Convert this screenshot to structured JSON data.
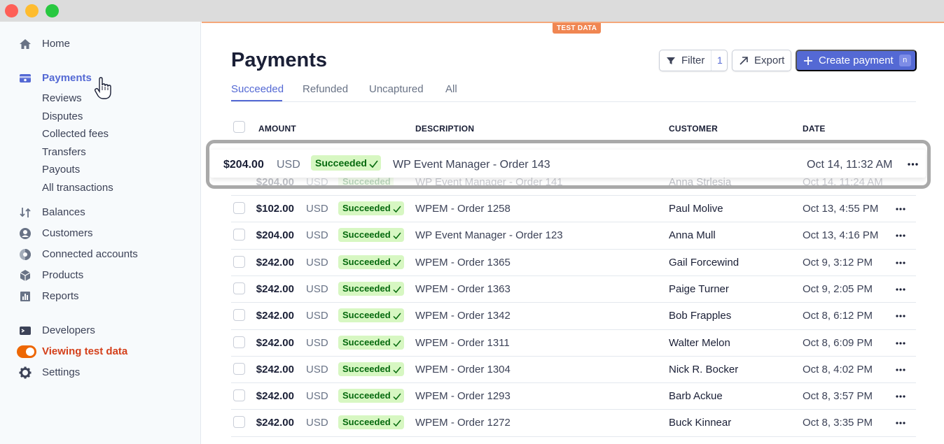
{
  "window": {
    "controls": [
      "close",
      "minimize",
      "maximize"
    ]
  },
  "env_badge": "TEST DATA",
  "sidebar": {
    "home": {
      "label": "Home",
      "icon": "home-icon"
    },
    "payments": {
      "label": "Payments",
      "icon": "payments-icon",
      "subitems": [
        "Reviews",
        "Disputes",
        "Collected fees",
        "Transfers",
        "Payouts",
        "All transactions"
      ]
    },
    "items": [
      {
        "label": "Balances",
        "icon": "balances-icon"
      },
      {
        "label": "Customers",
        "icon": "customers-icon"
      },
      {
        "label": "Connected accounts",
        "icon": "connected-accounts-icon"
      },
      {
        "label": "Products",
        "icon": "products-icon"
      },
      {
        "label": "Reports",
        "icon": "reports-icon"
      }
    ],
    "developers": {
      "label": "Developers",
      "icon": "terminal-icon"
    },
    "test_mode": {
      "label": "Viewing test data",
      "on": true
    },
    "settings": {
      "label": "Settings",
      "icon": "gear-icon"
    }
  },
  "main": {
    "title": "Payments",
    "toolbar": {
      "filter_label": "Filter",
      "filter_count": "1",
      "export_label": "Export",
      "create_label": "Create payment",
      "create_shortcut": "n"
    },
    "tabs": [
      "Succeeded",
      "Refunded",
      "Uncaptured",
      "All"
    ],
    "active_tab": "Succeeded",
    "columns": {
      "amount": "AMOUNT",
      "description": "DESCRIPTION",
      "customer": "CUSTOMER",
      "date": "DATE"
    },
    "highlighted_row": {
      "amount": "$204.00",
      "currency": "USD",
      "status": "Succeeded",
      "description": "WP Event Manager - Order 143",
      "date": "Oct 14, 11:32 AM"
    },
    "ghost_row": {
      "amount": "$204.00",
      "currency": "USD",
      "status": "Succeeded",
      "description": "WP Event Manager - Order 141",
      "customer": "Anna Strlesia",
      "date": "Oct 14, 11:24 AM"
    },
    "rows": [
      {
        "amount": "$102.00",
        "currency": "USD",
        "status": "Succeeded",
        "description": "WPEM - Order 1258",
        "customer": "Paul Molive",
        "date": "Oct 13, 4:55 PM"
      },
      {
        "amount": "$204.00",
        "currency": "USD",
        "status": "Succeeded",
        "description": "WP Event Manager - Order 123",
        "customer": "Anna Mull",
        "date": "Oct 13, 4:16 PM"
      },
      {
        "amount": "$242.00",
        "currency": "USD",
        "status": "Succeeded",
        "description": "WPEM - Order 1365",
        "customer": "Gail Forcewind",
        "date": "Oct 9, 3:12 PM"
      },
      {
        "amount": "$242.00",
        "currency": "USD",
        "status": "Succeeded",
        "description": "WPEM - Order 1363",
        "customer": "Paige Turner",
        "date": "Oct 9, 2:05 PM"
      },
      {
        "amount": "$242.00",
        "currency": "USD",
        "status": "Succeeded",
        "description": "WPEM - Order 1342",
        "customer": "Bob Frapples",
        "date": "Oct 8, 6:12 PM"
      },
      {
        "amount": "$242.00",
        "currency": "USD",
        "status": "Succeeded",
        "description": "WPEM - Order 1311",
        "customer": "Walter Melon",
        "date": "Oct 8, 6:09 PM"
      },
      {
        "amount": "$242.00",
        "currency": "USD",
        "status": "Succeeded",
        "description": "WPEM - Order 1304",
        "customer": "Nick R. Bocker",
        "date": "Oct 8, 4:02 PM"
      },
      {
        "amount": "$242.00",
        "currency": "USD",
        "status": "Succeeded",
        "description": "WPEM - Order 1293",
        "customer": "Barb Ackue",
        "date": "Oct 8, 3:57 PM"
      },
      {
        "amount": "$242.00",
        "currency": "USD",
        "status": "Succeeded",
        "description": "WPEM - Order 1272",
        "customer": "Buck Kinnear",
        "date": "Oct 8, 3:35 PM"
      }
    ]
  },
  "colors": {
    "accent": "#5469d4",
    "success_bg": "#d7f7c2",
    "success_text": "#05690d",
    "test_orange": "#f08652"
  }
}
